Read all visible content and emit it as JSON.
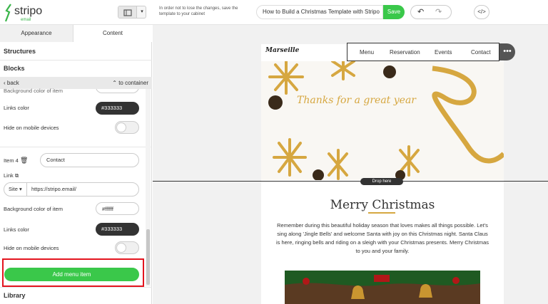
{
  "app": {
    "logo_text": "stripo",
    "logo_sub": "email",
    "brand_green": "#3ab54a"
  },
  "toolbar": {
    "notice": "In order not to lose the changes, save the template to your cabinet",
    "subject": "How to Build a Christmas Template with Stripo",
    "save_label": "Save",
    "view_icon": "desktop-view-icon",
    "undo_icon": "undo-icon",
    "redo_icon": "redo-icon",
    "code_label": "</>"
  },
  "sidebar": {
    "tabs": [
      {
        "label": "Appearance"
      },
      {
        "label": "Content"
      }
    ],
    "sections": {
      "structures": "Structures",
      "blocks": "Blocks",
      "library": "Library"
    },
    "back_label": "back",
    "container_label": "to container",
    "upper": {
      "bg_label": "Background color of item",
      "links_label": "Links color",
      "links_color": "#333333",
      "hide_label": "Hide on mobile devices"
    },
    "item4": {
      "item_label": "Item 4",
      "item_value": "Contact",
      "link_label": "Link",
      "link_type": "Site",
      "link_value": "https://stripo.email/",
      "bg_label": "Background color of item",
      "bg_color": "#ffffff",
      "links_label": "Links color",
      "links_color": "#333333",
      "hide_label": "Hide on mobile devices"
    },
    "add_menu_item": "Add menu item"
  },
  "email": {
    "brand": "Marseille",
    "menu": [
      "Menu",
      "Reservation",
      "Events",
      "Contact"
    ],
    "hero_text": "Thanks for a great year",
    "drop_label": "Drop here",
    "title": "Merry Christmas",
    "body": "Remember during this beautiful holiday season that loves makes all things possible. Let's sing along 'Jingle Bells' and welcome Santa with joy on this Christmas night. Santa Claus is here, ringing bells and riding on a sleigh with your Christmas presents. Merry Christmas to you and your family."
  },
  "colors": {
    "accent_green": "#3ac84a",
    "gold": "#d6a740",
    "highlight_red": "#e3141e"
  }
}
